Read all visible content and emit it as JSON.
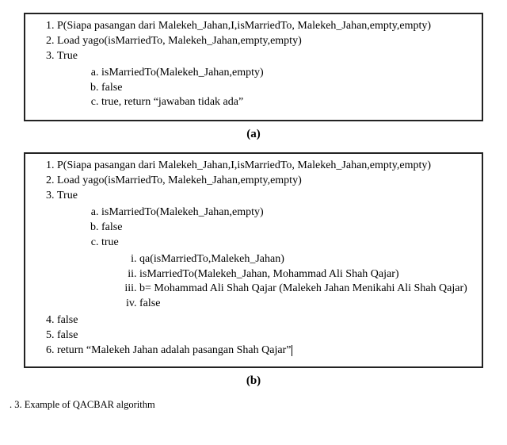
{
  "boxA": {
    "line1": "P(Siapa pasangan dari Malekeh_Jahan,I,isMarriedTo, Malekeh_Jahan,empty,empty)",
    "line2": "Load yago(isMarriedTo, Malekeh_Jahan,empty,empty)",
    "line3": "True",
    "a": "isMarriedTo(Malekeh_Jahan,empty)",
    "b": "false",
    "c": "true, return “jawaban tidak ada”"
  },
  "captionA": "(a)",
  "boxB": {
    "line1": "P(Siapa pasangan dari Malekeh_Jahan,I,isMarriedTo, Malekeh_Jahan,empty,empty)",
    "line2": "Load yago(isMarriedTo, Malekeh_Jahan,empty,empty)",
    "line3": "True",
    "a": "isMarriedTo(Malekeh_Jahan,empty)",
    "b": "false",
    "c": "true",
    "i": "qa(isMarriedTo,Malekeh_Jahan)",
    "ii": "isMarriedTo(Malekeh_Jahan, Mohammad Ali Shah Qajar)",
    "iii": "b= Mohammad Ali Shah Qajar (Malekeh Jahan Menikahi Ali Shah Qajar)",
    "iv": "false",
    "line4": "false",
    "line5": "false",
    "line6": "return “Malekeh Jahan adalah pasangan Shah Qajar”"
  },
  "captionB": "(b)",
  "figline": ". 3.   Example of QACBAR algorithm"
}
